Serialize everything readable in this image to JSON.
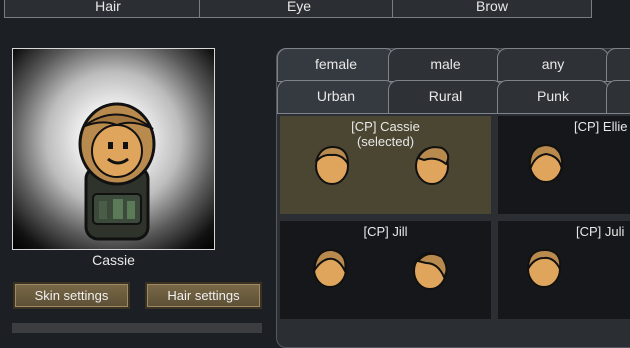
{
  "top_tabs": [
    {
      "label": "Hair"
    },
    {
      "label": "Eye"
    },
    {
      "label": "Brow"
    }
  ],
  "preview": {
    "name": "Cassie"
  },
  "buttons": {
    "skin": "Skin settings",
    "hair": "Hair settings"
  },
  "filter_tabs": {
    "gender": [
      "female",
      "male",
      "any"
    ],
    "style": [
      "Urban",
      "Rural",
      "Punk"
    ]
  },
  "styles": [
    {
      "label": "[CP] Cassie\n(selected)",
      "selected": true
    },
    {
      "label": "[CP] Ellie",
      "selected": false
    },
    {
      "label": "[CP] Jill",
      "selected": false
    },
    {
      "label": "[CP] Juli",
      "selected": false
    }
  ],
  "colors": {
    "accent": "#4a4631",
    "button": "#6b5b3e",
    "hair": "#b98a4e",
    "skin": "#e0a55c"
  }
}
